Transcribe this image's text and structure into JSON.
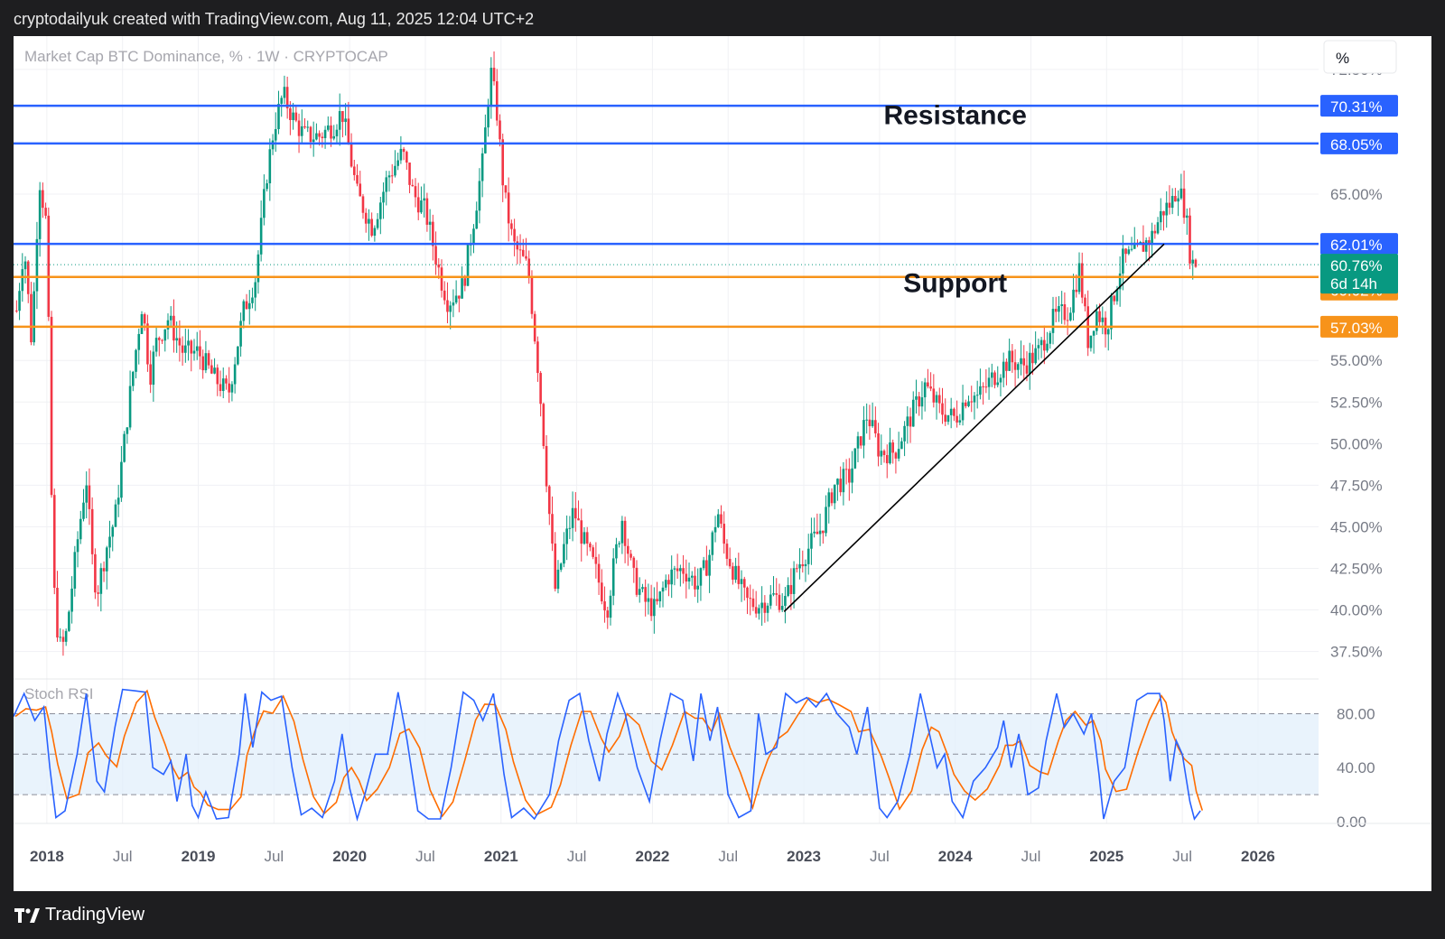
{
  "header": {
    "caption": "cryptodailyuk created with TradingView.com, Aug 11, 2025 12:04 UTC+2"
  },
  "footer": {
    "brand": "TradingView"
  },
  "chart_data": [
    {
      "type": "candlestick",
      "title": "Market Cap BTC Dominance, % · 1W · CRYPTOCAP",
      "scale_button": "%",
      "ylim": [
        36.5,
        74.5
      ],
      "xlim": [
        2017.78,
        2026.4
      ],
      "price_ticks": [
        "72.50%",
        "65.00%",
        "55.00%",
        "52.50%",
        "50.00%",
        "47.50%",
        "45.00%",
        "42.50%",
        "40.00%",
        "37.50%"
      ],
      "price_tick_values": [
        72.5,
        65,
        55,
        52.5,
        50,
        47.5,
        45,
        42.5,
        40,
        37.5
      ],
      "x_ticks": [
        {
          "label": "2018",
          "t": 2018.0,
          "bold": true
        },
        {
          "label": "Jul",
          "t": 2018.5,
          "bold": false
        },
        {
          "label": "2019",
          "t": 2019.0,
          "bold": true
        },
        {
          "label": "Jul",
          "t": 2019.5,
          "bold": false
        },
        {
          "label": "2020",
          "t": 2020.0,
          "bold": true
        },
        {
          "label": "Jul",
          "t": 2020.5,
          "bold": false
        },
        {
          "label": "2021",
          "t": 2021.0,
          "bold": true
        },
        {
          "label": "Jul",
          "t": 2021.5,
          "bold": false
        },
        {
          "label": "2022",
          "t": 2022.0,
          "bold": true
        },
        {
          "label": "Jul",
          "t": 2022.5,
          "bold": false
        },
        {
          "label": "2023",
          "t": 2023.0,
          "bold": true
        },
        {
          "label": "Jul",
          "t": 2023.5,
          "bold": false
        },
        {
          "label": "2024",
          "t": 2024.0,
          "bold": true
        },
        {
          "label": "Jul",
          "t": 2024.5,
          "bold": false
        },
        {
          "label": "2025",
          "t": 2025.0,
          "bold": true
        },
        {
          "label": "Jul",
          "t": 2025.5,
          "bold": false
        },
        {
          "label": "2026",
          "t": 2026.0,
          "bold": true
        }
      ],
      "horizontal_levels": [
        {
          "value": 70.31,
          "label": "70.31%",
          "color": "#2962ff"
        },
        {
          "value": 68.05,
          "label": "68.05%",
          "color": "#2962ff"
        },
        {
          "value": 62.01,
          "label": "62.01%",
          "color": "#2962ff"
        },
        {
          "value": 60.02,
          "label": "60.02%",
          "color": "#f7931a"
        },
        {
          "value": 57.03,
          "label": "57.03%",
          "color": "#f7931a"
        }
      ],
      "current_price": {
        "value": 60.76,
        "label": "60.76%",
        "countdown": "6d 14h",
        "color": "#089981"
      },
      "annotations": [
        {
          "text": "Resistance",
          "t": 2024.0,
          "y": 69.2
        },
        {
          "text": "Support",
          "t": 2024.0,
          "y": 59.1
        }
      ],
      "trendline": {
        "from": {
          "t": 2022.87,
          "y": 39.9
        },
        "to": {
          "t": 2025.38,
          "y": 62.0
        },
        "color": "#000000"
      },
      "up_color": "#089981",
      "down_color": "#f23645",
      "series_anchors": [
        [
          2017.8,
          58
        ],
        [
          2017.85,
          62
        ],
        [
          2017.9,
          56
        ],
        [
          2017.95,
          66
        ],
        [
          2018.0,
          63
        ],
        [
          2018.04,
          42
        ],
        [
          2018.08,
          37.8
        ],
        [
          2018.12,
          38
        ],
        [
          2018.2,
          44
        ],
        [
          2018.26,
          48
        ],
        [
          2018.3,
          43
        ],
        [
          2018.33,
          41
        ],
        [
          2018.4,
          44
        ],
        [
          2018.45,
          45.5
        ],
        [
          2018.55,
          53
        ],
        [
          2018.63,
          58.5
        ],
        [
          2018.68,
          54
        ],
        [
          2018.72,
          56
        ],
        [
          2018.8,
          57.5
        ],
        [
          2018.9,
          55.5
        ],
        [
          2019.0,
          55.5
        ],
        [
          2019.1,
          54
        ],
        [
          2019.2,
          53
        ],
        [
          2019.3,
          58
        ],
        [
          2019.38,
          60
        ],
        [
          2019.45,
          66
        ],
        [
          2019.5,
          69
        ],
        [
          2019.56,
          71
        ],
        [
          2019.63,
          69.5
        ],
        [
          2019.7,
          68.5
        ],
        [
          2019.8,
          68.5
        ],
        [
          2019.9,
          69.2
        ],
        [
          2019.95,
          70
        ],
        [
          2020.05,
          65
        ],
        [
          2020.15,
          63
        ],
        [
          2020.25,
          66
        ],
        [
          2020.35,
          67.5
        ],
        [
          2020.42,
          65
        ],
        [
          2020.5,
          64
        ],
        [
          2020.6,
          60
        ],
        [
          2020.65,
          58.5
        ],
        [
          2020.75,
          59.5
        ],
        [
          2020.82,
          63.5
        ],
        [
          2020.88,
          67
        ],
        [
          2020.93,
          72.5
        ],
        [
          2020.97,
          70.2
        ],
        [
          2021.02,
          65
        ],
        [
          2021.08,
          62
        ],
        [
          2021.18,
          60.5
        ],
        [
          2021.25,
          54
        ],
        [
          2021.3,
          48
        ],
        [
          2021.36,
          41
        ],
        [
          2021.42,
          44
        ],
        [
          2021.48,
          46
        ],
        [
          2021.55,
          44
        ],
        [
          2021.62,
          42.5
        ],
        [
          2021.7,
          40
        ],
        [
          2021.75,
          43
        ],
        [
          2021.8,
          45.5
        ],
        [
          2021.87,
          42
        ],
        [
          2021.95,
          40.5
        ],
        [
          2022.02,
          40
        ],
        [
          2022.1,
          42
        ],
        [
          2022.2,
          42.5
        ],
        [
          2022.3,
          41.5
        ],
        [
          2022.37,
          43
        ],
        [
          2022.43,
          46
        ],
        [
          2022.47,
          44
        ],
        [
          2022.55,
          42
        ],
        [
          2022.62,
          40.5
        ],
        [
          2022.7,
          40.3
        ],
        [
          2022.8,
          40.8
        ],
        [
          2022.88,
          40.5
        ],
        [
          2022.95,
          42.5
        ],
        [
          2023.05,
          44
        ],
        [
          2023.12,
          45
        ],
        [
          2023.2,
          47.5
        ],
        [
          2023.3,
          48
        ],
        [
          2023.42,
          51.8
        ],
        [
          2023.5,
          49.5
        ],
        [
          2023.6,
          49.5
        ],
        [
          2023.7,
          51.5
        ],
        [
          2023.8,
          53.5
        ],
        [
          2023.9,
          52
        ],
        [
          2024.0,
          51.5
        ],
        [
          2024.08,
          53
        ],
        [
          2024.15,
          52.8
        ],
        [
          2024.25,
          54
        ],
        [
          2024.35,
          55
        ],
        [
          2024.45,
          54.7
        ],
        [
          2024.55,
          55.5
        ],
        [
          2024.65,
          57.5
        ],
        [
          2024.75,
          58
        ],
        [
          2024.82,
          60.5
        ],
        [
          2024.88,
          56
        ],
        [
          2024.93,
          58
        ],
        [
          2025.0,
          57
        ],
        [
          2025.05,
          59
        ],
        [
          2025.1,
          61
        ],
        [
          2025.2,
          61.5
        ],
        [
          2025.3,
          62.5
        ],
        [
          2025.37,
          64
        ],
        [
          2025.43,
          64.5
        ],
        [
          2025.47,
          65.5
        ],
        [
          2025.52,
          64
        ],
        [
          2025.56,
          60.7
        ],
        [
          2025.58,
          61
        ],
        [
          2025.6,
          60.76
        ]
      ],
      "indicator": {
        "name": "Stoch RSI",
        "ticks": [
          "80.00",
          "40.00",
          "0.00"
        ],
        "levels": [
          80,
          50,
          20
        ],
        "k_color": "#2962ff",
        "d_color": "#ff6d00",
        "k_anchors": [
          [
            2017.78,
            78
          ],
          [
            2017.85,
            95
          ],
          [
            2017.92,
            75
          ],
          [
            2017.98,
            85
          ],
          [
            2018.02,
            40
          ],
          [
            2018.06,
            3
          ],
          [
            2018.12,
            8
          ],
          [
            2018.2,
            50
          ],
          [
            2018.26,
            95
          ],
          [
            2018.33,
            30
          ],
          [
            2018.38,
            22
          ],
          [
            2018.45,
            70
          ],
          [
            2018.5,
            98
          ],
          [
            2018.58,
            97
          ],
          [
            2018.65,
            96
          ],
          [
            2018.7,
            40
          ],
          [
            2018.77,
            35
          ],
          [
            2018.82,
            45
          ],
          [
            2018.86,
            15
          ],
          [
            2018.92,
            50
          ],
          [
            2018.96,
            12
          ],
          [
            2019.0,
            3
          ],
          [
            2019.05,
            22
          ],
          [
            2019.12,
            2
          ],
          [
            2019.2,
            3
          ],
          [
            2019.27,
            50
          ],
          [
            2019.31,
            95
          ],
          [
            2019.36,
            55
          ],
          [
            2019.42,
            96
          ],
          [
            2019.48,
            90
          ],
          [
            2019.55,
            93
          ],
          [
            2019.62,
            40
          ],
          [
            2019.68,
            5
          ],
          [
            2019.75,
            10
          ],
          [
            2019.82,
            3
          ],
          [
            2019.9,
            30
          ],
          [
            2019.95,
            65
          ],
          [
            2020.0,
            25
          ],
          [
            2020.05,
            2
          ],
          [
            2020.1,
            20
          ],
          [
            2020.17,
            50
          ],
          [
            2020.25,
            50
          ],
          [
            2020.32,
            96
          ],
          [
            2020.38,
            60
          ],
          [
            2020.45,
            8
          ],
          [
            2020.52,
            2
          ],
          [
            2020.6,
            2
          ],
          [
            2020.67,
            40
          ],
          [
            2020.75,
            96
          ],
          [
            2020.82,
            90
          ],
          [
            2020.88,
            75
          ],
          [
            2020.95,
            95
          ],
          [
            2021.02,
            35
          ],
          [
            2021.07,
            3
          ],
          [
            2021.15,
            10
          ],
          [
            2021.22,
            2
          ],
          [
            2021.32,
            20
          ],
          [
            2021.38,
            60
          ],
          [
            2021.45,
            90
          ],
          [
            2021.52,
            95
          ],
          [
            2021.58,
            60
          ],
          [
            2021.65,
            30
          ],
          [
            2021.7,
            65
          ],
          [
            2021.77,
            95
          ],
          [
            2021.82,
            80
          ],
          [
            2021.9,
            40
          ],
          [
            2021.98,
            15
          ],
          [
            2022.05,
            60
          ],
          [
            2022.12,
            95
          ],
          [
            2022.2,
            90
          ],
          [
            2022.27,
            45
          ],
          [
            2022.32,
            95
          ],
          [
            2022.38,
            60
          ],
          [
            2022.43,
            85
          ],
          [
            2022.5,
            20
          ],
          [
            2022.57,
            3
          ],
          [
            2022.65,
            8
          ],
          [
            2022.7,
            80
          ],
          [
            2022.75,
            50
          ],
          [
            2022.82,
            55
          ],
          [
            2022.88,
            95
          ],
          [
            2022.95,
            88
          ],
          [
            2023.02,
            92
          ],
          [
            2023.08,
            85
          ],
          [
            2023.15,
            95
          ],
          [
            2023.22,
            80
          ],
          [
            2023.3,
            70
          ],
          [
            2023.35,
            50
          ],
          [
            2023.42,
            85
          ],
          [
            2023.5,
            10
          ],
          [
            2023.55,
            3
          ],
          [
            2023.62,
            15
          ],
          [
            2023.7,
            50
          ],
          [
            2023.77,
            95
          ],
          [
            2023.83,
            65
          ],
          [
            2023.88,
            40
          ],
          [
            2023.93,
            50
          ],
          [
            2023.98,
            15
          ],
          [
            2024.05,
            3
          ],
          [
            2024.12,
            30
          ],
          [
            2024.2,
            40
          ],
          [
            2024.28,
            55
          ],
          [
            2024.32,
            75
          ],
          [
            2024.37,
            40
          ],
          [
            2024.42,
            65
          ],
          [
            2024.48,
            20
          ],
          [
            2024.55,
            25
          ],
          [
            2024.6,
            60
          ],
          [
            2024.67,
            95
          ],
          [
            2024.72,
            70
          ],
          [
            2024.78,
            80
          ],
          [
            2024.85,
            65
          ],
          [
            2024.9,
            80
          ],
          [
            2024.95,
            35
          ],
          [
            2024.98,
            2
          ],
          [
            2025.05,
            30
          ],
          [
            2025.12,
            40
          ],
          [
            2025.2,
            90
          ],
          [
            2025.27,
            95
          ],
          [
            2025.35,
            95
          ],
          [
            2025.38,
            75
          ],
          [
            2025.42,
            30
          ],
          [
            2025.46,
            60
          ],
          [
            2025.5,
            50
          ],
          [
            2025.55,
            15
          ],
          [
            2025.58,
            2
          ],
          [
            2025.62,
            8
          ]
        ]
      }
    }
  ]
}
